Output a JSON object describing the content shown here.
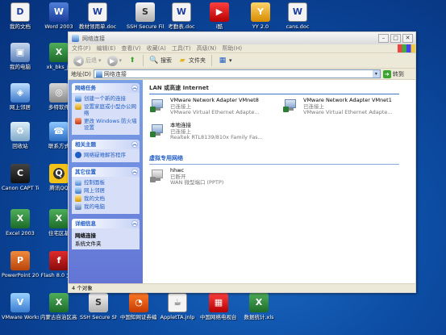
{
  "desktop": {
    "icons": [
      {
        "id": "mydocs",
        "label": "我的文档",
        "glyph": "D",
        "icon": "folder-documents-icon",
        "cls": "ic-doc"
      },
      {
        "id": "word2003",
        "label": "Word 2003",
        "glyph": "W",
        "icon": "word-icon",
        "cls": "ic-word"
      },
      {
        "id": "doc1",
        "label": "教材领用单.doc",
        "glyph": "W",
        "icon": "word-document-icon",
        "cls": "ic-doc"
      },
      {
        "id": "sshft",
        "label": "SSH Secure File Transfer Client",
        "glyph": "S",
        "icon": "ssh-file-transfer-icon",
        "cls": "ic-ssh"
      },
      {
        "id": "kaoqin",
        "label": "考勤表.doc",
        "glyph": "W",
        "icon": "word-document-icon",
        "cls": "ic-doc"
      },
      {
        "id": "kugou",
        "label": "i酷",
        "glyph": "▶",
        "icon": "media-player-icon",
        "cls": "ic-media"
      },
      {
        "id": "yy",
        "label": "YY 2.0",
        "glyph": "Y",
        "icon": "yy-icon",
        "cls": "ic-yy"
      },
      {
        "id": "canshu",
        "label": "cans.doc",
        "glyph": "W",
        "icon": "word-document-icon",
        "cls": "ic-doc"
      },
      {
        "id": "mypc",
        "label": "我的电脑",
        "glyph": "▣",
        "icon": "my-computer-icon",
        "cls": "ic-pc"
      },
      {
        "id": "xls1",
        "label": "xk_bks_jc",
        "glyph": "X",
        "icon": "excel-document-icon",
        "cls": "ic-excel"
      },
      {
        "id": "netnb",
        "label": "网上邻居",
        "glyph": "◈",
        "icon": "network-places-icon",
        "cls": "ic-net"
      },
      {
        "id": "multisoft",
        "label": "多特软件",
        "glyph": "◎",
        "icon": "software-icon",
        "cls": "ic-soft"
      },
      {
        "id": "recycle",
        "label": "回收站",
        "glyph": "♻",
        "icon": "recycle-bin-icon",
        "cls": "ic-recycle"
      },
      {
        "id": "connect",
        "label": "联系方式",
        "glyph": "☎",
        "icon": "contact-icon",
        "cls": "ic-connect"
      },
      {
        "id": "canon",
        "label": "Canon CAPT Tools",
        "glyph": "C",
        "icon": "canon-printer-icon",
        "cls": "ic-canon"
      },
      {
        "id": "qq",
        "label": "腾讯QQ",
        "glyph": "Q",
        "icon": "qq-icon",
        "cls": "ic-qq"
      },
      {
        "id": "excel2003",
        "label": "Excel 2003",
        "glyph": "X",
        "icon": "excel-icon",
        "cls": "ic-excel"
      },
      {
        "id": "zhuhai",
        "label": "住宅区基",
        "glyph": "X",
        "icon": "excel-document-icon",
        "cls": "ic-excel"
      },
      {
        "id": "ppt2003",
        "label": "PowerPoint 2003",
        "glyph": "P",
        "icon": "powerpoint-icon",
        "cls": "ic-ppt"
      },
      {
        "id": "flash8",
        "label": "Flash 8.0 文影",
        "glyph": "f",
        "icon": "flash-icon",
        "cls": "ic-flash"
      },
      {
        "id": "vmware",
        "label": "VMware Workstation",
        "glyph": "V",
        "icon": "vmware-icon",
        "cls": "ic-vm"
      },
      {
        "id": "xls2",
        "label": "内蒙古自治区高校信息化学...",
        "glyph": "X",
        "icon": "excel-document-icon",
        "cls": "ic-excel"
      },
      {
        "id": "sshshell",
        "label": "SSH Secure Shell Client",
        "glyph": "S",
        "icon": "ssh-shell-icon",
        "cls": "ic-ssh"
      },
      {
        "id": "cnki",
        "label": "中国知网证券编 主席V5",
        "glyph": "◔",
        "icon": "cnki-icon",
        "cls": "ic-db"
      },
      {
        "id": "jnlp",
        "label": "AppletTA.jnlp",
        "glyph": "☕",
        "icon": "jnlp-file-icon",
        "cls": "ic-jnlp"
      },
      {
        "id": "cbox",
        "label": "中国网络电视台 CBox网络电视...",
        "glyph": "▦",
        "icon": "cbox-icon",
        "cls": "ic-media"
      },
      {
        "id": "shuzi",
        "label": "数据统计.xls",
        "glyph": "X",
        "icon": "excel-document-icon",
        "cls": "ic-excel"
      }
    ]
  },
  "window": {
    "title": "网络连接",
    "menus": [
      "文件(F)",
      "编辑(E)",
      "查看(V)",
      "收藏(A)",
      "工具(T)",
      "高级(N)",
      "帮助(H)"
    ],
    "toolbar": {
      "back": "后退",
      "search": "搜索",
      "folders": "文件夹"
    },
    "address": {
      "label": "地址(D)",
      "value": "网络连接",
      "go": "转到"
    },
    "tasks": {
      "network_tasks": {
        "title": "网络任务",
        "items": [
          "创建一个新的连接",
          "设置家庭或小型办公网络",
          "更改 Windows 防火墙设置"
        ]
      },
      "related": {
        "title": "相关主题",
        "items": [
          "网络疑难解答程序"
        ]
      },
      "other_places": {
        "title": "其它位置",
        "items": [
          "控制面板",
          "网上邻居",
          "我的文档",
          "我的电脑"
        ]
      },
      "details": {
        "title": "详细信息",
        "name": "网络连接",
        "sub": "系统文件夹"
      }
    },
    "lan_group": "LAN 或高速 Internet",
    "vpn_group": "虚拟专用网络",
    "adapters": [
      {
        "name": "VMware Network Adapter VMnet8",
        "status": "已连接上",
        "desc": "VMware Virtual Ethernet Adapte..."
      },
      {
        "name": "VMware Network Adapter VMnet1",
        "status": "已连接上",
        "desc": "VMware Virtual Ethernet Adapte..."
      },
      {
        "name": "本地连接",
        "status": "已连接上",
        "desc": "Realtek RTL8139/810x Family Fas..."
      }
    ],
    "vpn": [
      {
        "name": "hhwc",
        "status": "已断开",
        "desc": "WAN 微型端口 (PPTP)"
      }
    ],
    "status": "4 个对象"
  }
}
